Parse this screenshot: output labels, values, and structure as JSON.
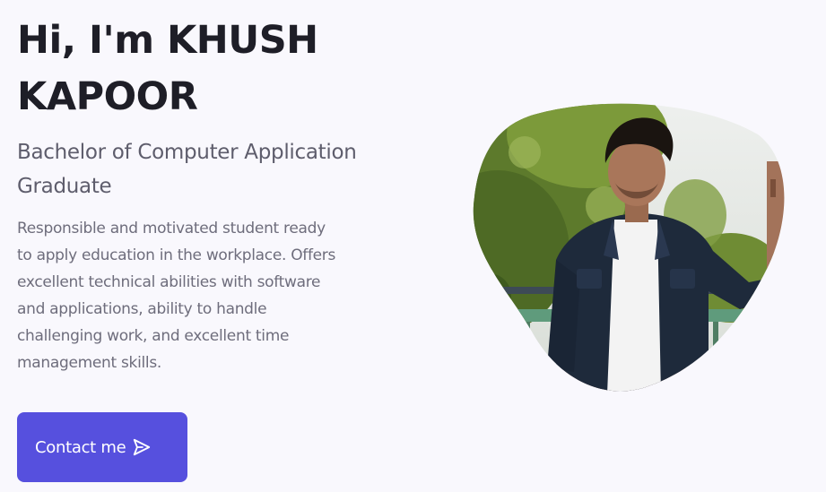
{
  "hero": {
    "name_line1": "Hi, I'm KHUSH",
    "name_line2": "KAPOOR",
    "subtitle_line1": "Bachelor of Computer Application",
    "subtitle_line2": "Graduate",
    "description_lines": [
      "Responsible and motivated student ready",
      "to apply education in the workplace. Offers",
      "excellent technical abilities with software",
      "and applications, ability to handle",
      "challenging work, and excellent time",
      "management skills."
    ],
    "contact_label": "Contact me",
    "contact_icon": "send-icon"
  },
  "colors": {
    "background": "#f9f8fd",
    "heading": "#1e1e27",
    "subtitle": "#5e5d6c",
    "body_text": "#6e6d7c",
    "accent": "#5650de"
  }
}
